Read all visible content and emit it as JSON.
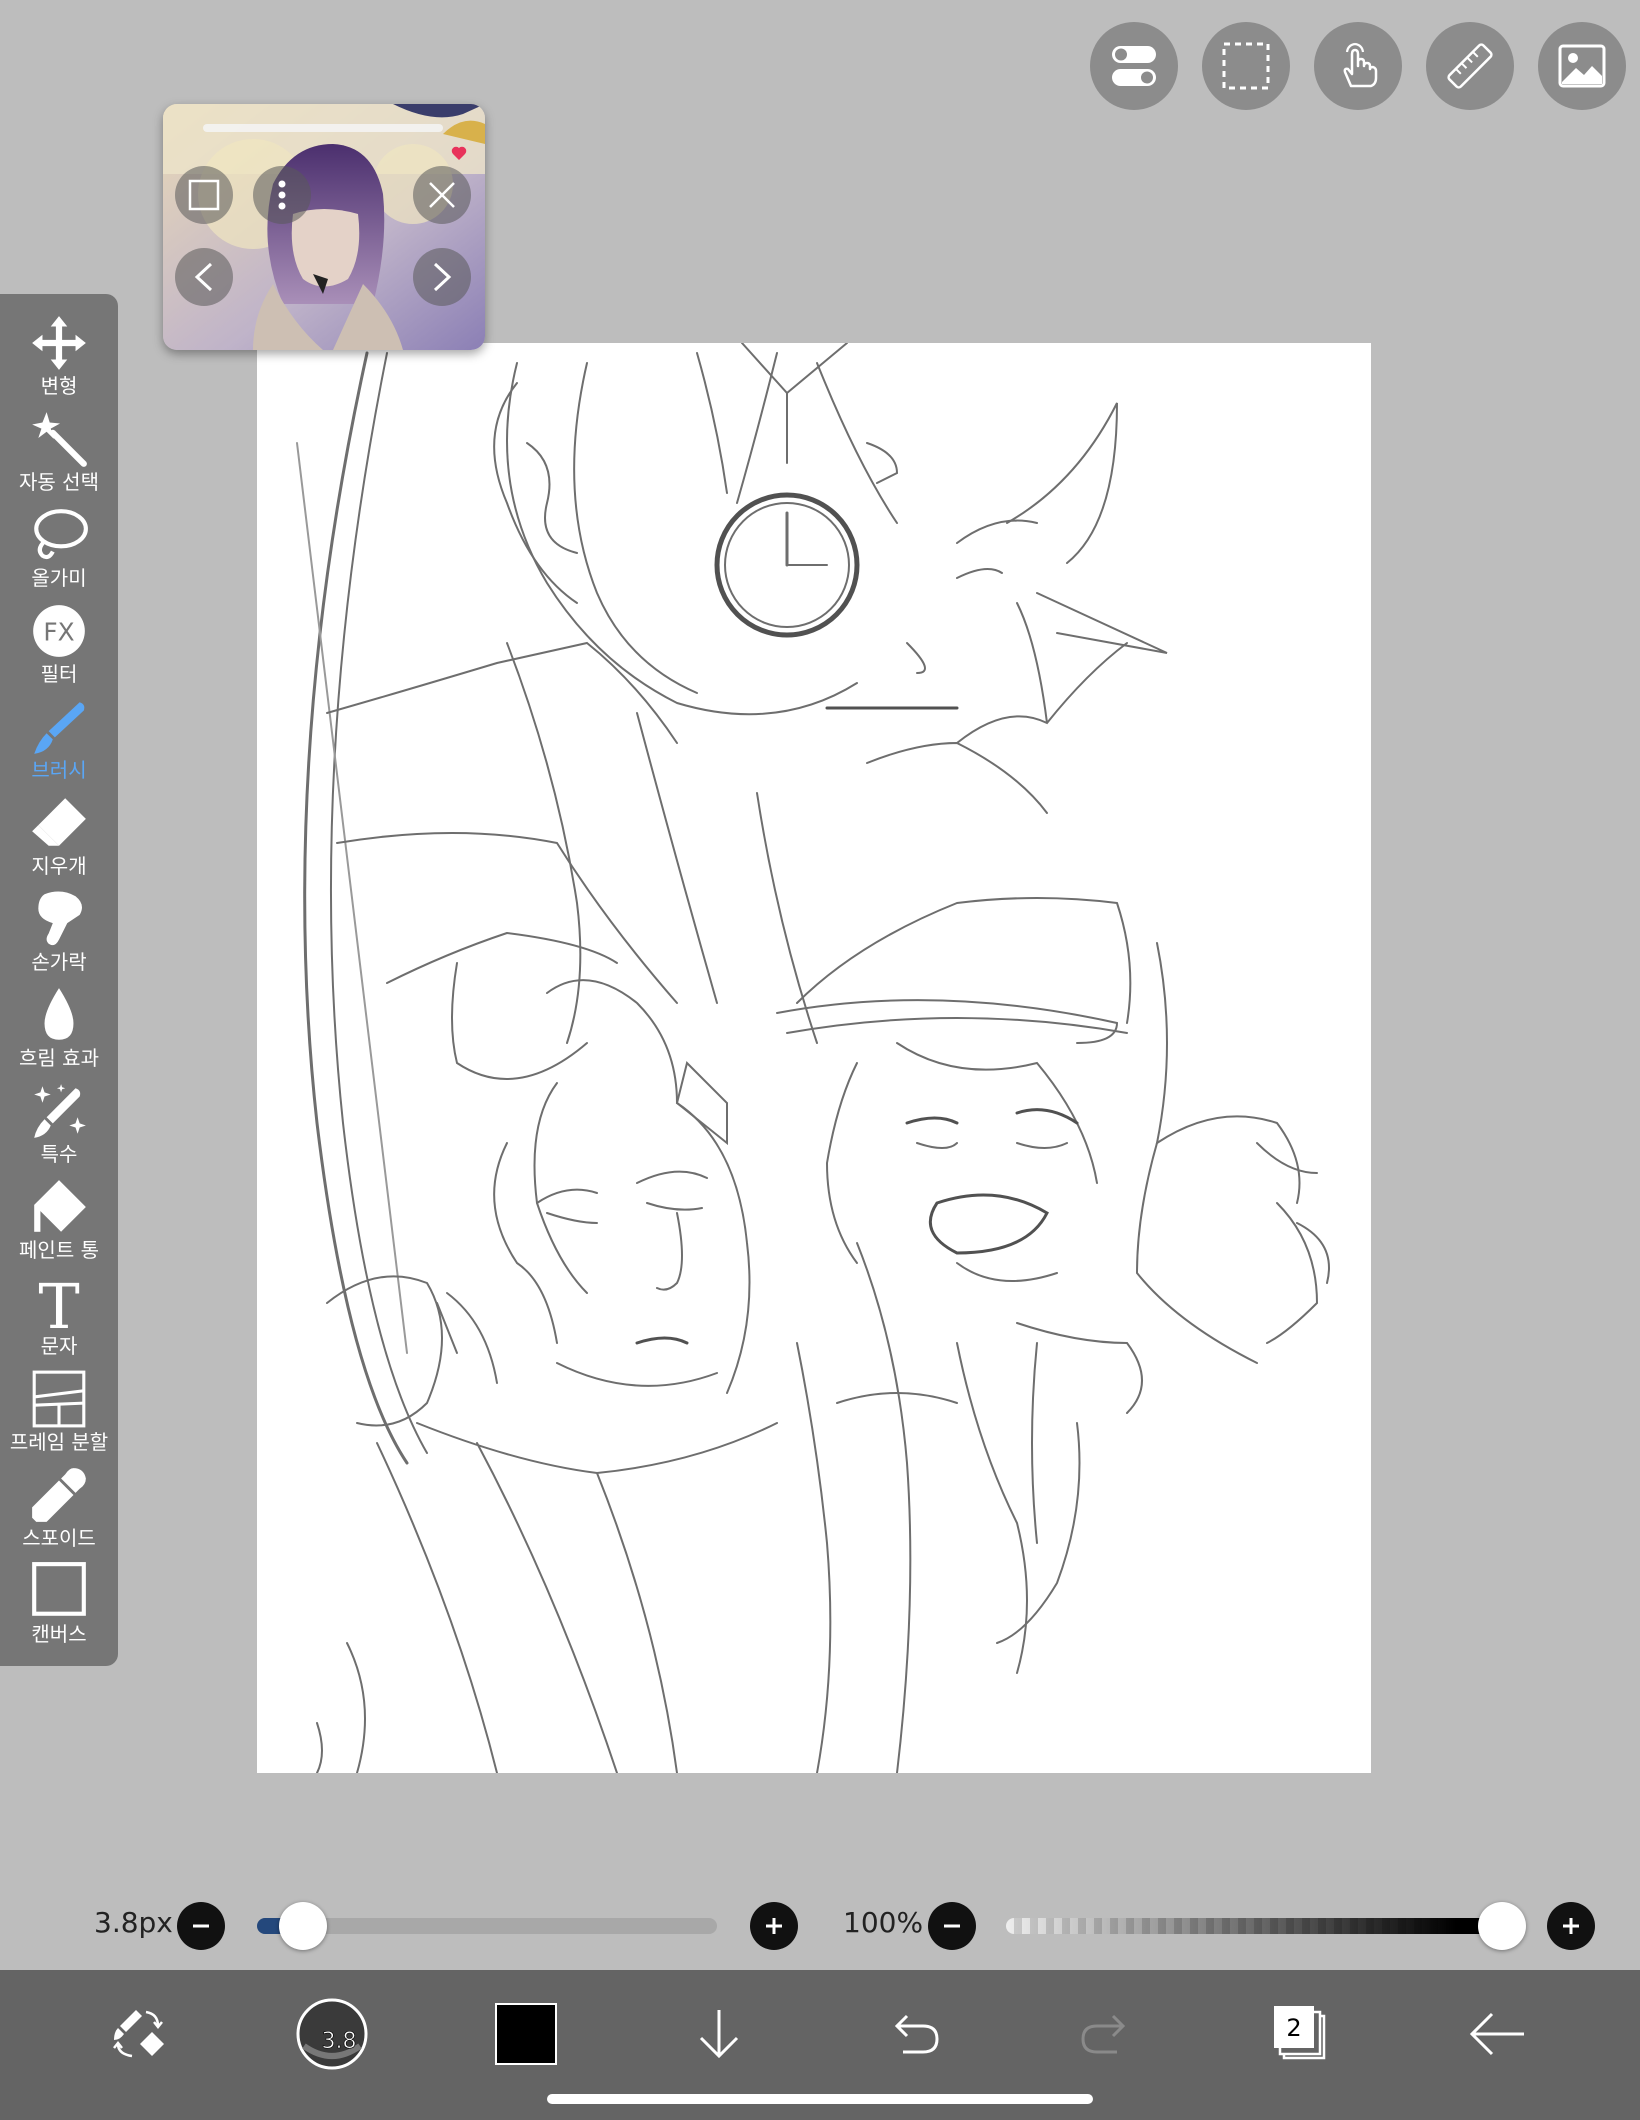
{
  "top_tools": [
    {
      "name": "toggle-switch-icon"
    },
    {
      "name": "selection-rect-icon"
    },
    {
      "name": "touch-hand-icon"
    },
    {
      "name": "ruler-icon"
    },
    {
      "name": "image-icon"
    }
  ],
  "toolbar": {
    "items": [
      {
        "label": "변형",
        "icon": "move-arrows-icon"
      },
      {
        "label": "자동 선택",
        "icon": "magic-wand-icon"
      },
      {
        "label": "올가미",
        "icon": "lasso-icon"
      },
      {
        "label": "필터",
        "icon": "fx-icon",
        "glyph": "FX"
      },
      {
        "label": "브러시",
        "icon": "brush-icon",
        "active": true
      },
      {
        "label": "지우개",
        "icon": "eraser-icon"
      },
      {
        "label": "손가락",
        "icon": "finger-smudge-icon"
      },
      {
        "label": "흐림 효과",
        "icon": "blur-drop-icon"
      },
      {
        "label": "특수",
        "icon": "special-brush-icon"
      },
      {
        "label": "페인트 통",
        "icon": "paint-bucket-icon"
      },
      {
        "label": "문자",
        "icon": "text-tool-icon",
        "glyph": "T"
      },
      {
        "label": "프레임 분할",
        "icon": "frame-divide-icon"
      },
      {
        "label": "스포이드",
        "icon": "eyedropper-icon"
      },
      {
        "label": "캔버스",
        "icon": "canvas-icon"
      }
    ],
    "active_color": "#5aa6f5"
  },
  "reference_window": {
    "controls": [
      "resize-icon",
      "more-vertical-icon",
      "close-icon",
      "prev-icon",
      "next-icon"
    ]
  },
  "brush_size": {
    "label": "3.8px",
    "value": 3.8,
    "fraction": 0.07
  },
  "opacity": {
    "label": "100%",
    "value": 100
  },
  "bottom_bar": {
    "brush_size_badge": "3.8",
    "color": "#000000",
    "layer_count": "2"
  }
}
